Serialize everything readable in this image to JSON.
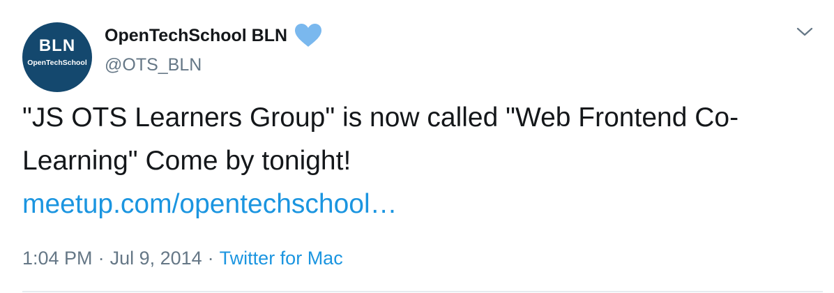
{
  "tweet": {
    "avatar": {
      "line1": "BLN",
      "line2": "OpenTechSchool",
      "bg_color": "#14486e"
    },
    "author": {
      "display_name": "OpenTechSchool BLN",
      "handle": "@OTS_BLN",
      "badge_icon": "blue-heart-icon",
      "badge_color": "#7ab8ee"
    },
    "menu_icon": "chevron-down-icon",
    "text": "\"JS OTS Learners Group\" is now called \"Web Frontend Co-Learning\" Come by tonight!",
    "link": "meetup.com/opentechschool…",
    "time": "1:04 PM",
    "date": "Jul 9, 2014",
    "separator": "·",
    "source": "Twitter for Mac",
    "colors": {
      "text": "#14171a",
      "secondary": "#657786",
      "link": "#1b95e0"
    }
  }
}
